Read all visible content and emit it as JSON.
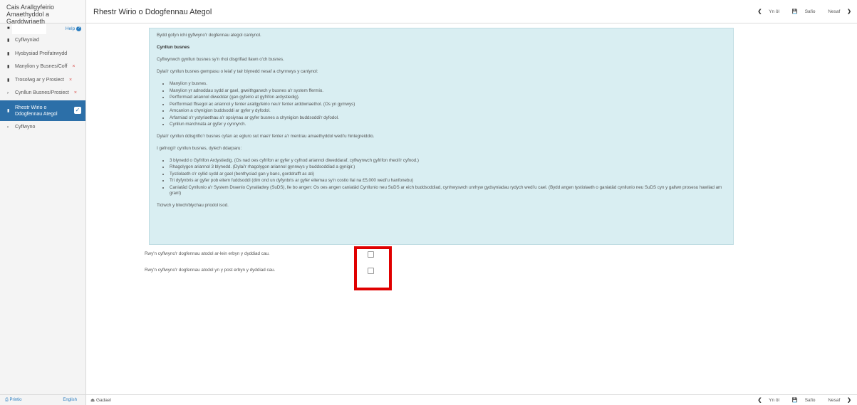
{
  "app": {
    "title_line1": "Cais Arallgyfeirio",
    "title_line2": "Amaethyddol a Garddwriaeth"
  },
  "user": {
    "help_label": "Help",
    "help_icon": "question-circle-icon"
  },
  "sidebar": {
    "items": [
      {
        "label": "Cyflwyniad",
        "icon": "document-icon",
        "error": ""
      },
      {
        "label": "Hysbysiad Preifatrwydd",
        "icon": "document-icon",
        "error": ""
      },
      {
        "label": "Manylion y Busnes/Coff",
        "icon": "document-icon",
        "error": "×"
      },
      {
        "label": "Trosolwg ar y Prosiect",
        "icon": "document-icon",
        "error": "×"
      },
      {
        "label": "Cynllun Busnes/Prosiect",
        "icon": "chevron-right-icon",
        "error": "×"
      },
      {
        "label_line1": "Rhestr Wirio o",
        "label_line2": "Ddogfennau Ategol",
        "icon": "document-icon",
        "active": true
      },
      {
        "label": "Cyflwyno",
        "icon": "chevron-right-icon",
        "error": ""
      }
    ],
    "print_label": "Printio",
    "english_label": "English"
  },
  "header": {
    "title": "Rhestr Wirio o Ddogfennau Ategol",
    "back_label": "Yn ôl",
    "save_label": "Safio",
    "next_label": "Nesaf"
  },
  "info": {
    "intro": "Bydd gofyn ichi gyflwyno'r dogfennau ategol canlynol.",
    "heading": "Cynllun busnes",
    "p1": "Cyflwynwch gynllun busnes sy'n rhoi disgrifiad llawn o'ch busnes.",
    "p2": "Dylai'r cynllun busnes gwmpasu o leiaf y tair blynedd nesaf a chynnwys y canlynol:",
    "list1": [
      "Manylion y busnes.",
      "Manylion yr adnoddau sydd ar gael, gweithgarwch y busnes a'r system ffermio.",
      "Perfformiad ariannol diweddar (gan gyfeirio at gyfrifon ardystiedig).",
      "Perfformiad ffisegol ac ariannol y fenter arallgyfeirio neu'r fenter arddwriaethol. (Os yn gymwys)",
      "Amcanion a chynigion buddsoddi ar gyfer y dyfodol.",
      "Arfarniad o'r ystyriaethau a'r opsiynau ar gyfer busnes a chynigion buddsoddi'r dyfodol.",
      "Cynllun marchnata ar gyfer y cynnyrch."
    ],
    "p3": "Dylai'r cynllun ddisgrifio'r busnes cyfan ac egluro sut mae'r fenter a'r mentrau amaethyddol wedi'u hintegreiddio.",
    "p4": "I gefnogi'r cynllun busnes, dylech ddarparu:",
    "list2": [
      "3 blynedd o Gyfrifon Ardystiedig. (Os nad oes cyfrifon ar gyfer y cyfnod ariannol diweddaraf, cyflwynwch gyfrifon rheoli'r cyfnod.)",
      "Rhagolygon ariannol 3 blynedd. (Dylai'r rhagolygon ariannol gynnwys y buddsoddiad a gynigir.)",
      "Tystiolaeth o'r cyllid sydd ar gael (benthyciad gan y banc, gorddrafft ac ati)",
      "Tri dyfynbris ar gyfer pob eitem fuddsoddi (dim ond un dyfynbris ar gyfer eitemau sy'n costio llai na £5,000 wedi'u hanfonebu)",
      "Caniatâd Cynllunio a'r System Draenio Cynaliadwy (SuDS), lle bo angen: Os oes angen caniatâd Cynllunio neu SuDS ar eich buddsoddiad, cynhwyswch unrhyw gydsyniadau rydych wedi'u cael. (Bydd angen tystiolaeth o ganiatâd cynllunio neu SuDS cyn y gallwn prosesu hawliad am grant)"
    ],
    "p5": "Ticiwch y blwch/blychau priodol isod."
  },
  "checkboxes": [
    {
      "label": "Rwy'n cyflwyno'r dogfennau atodol ar-lein erbyn y dyddiad cau.",
      "checked": false
    },
    {
      "label": "Rwy'n cyflwyno'r dogfennau atodol yn y post erbyn y dyddiad cau.",
      "checked": false
    }
  ],
  "footer": {
    "exit_label": "Gadael",
    "back_label": "Yn ôl",
    "save_label": "Safio",
    "next_label": "Nesaf"
  },
  "colors": {
    "active_nav": "#2c6fa8",
    "info_panel_bg": "#d9eef2",
    "highlight_border": "#e00000",
    "error": "#d9534f"
  }
}
